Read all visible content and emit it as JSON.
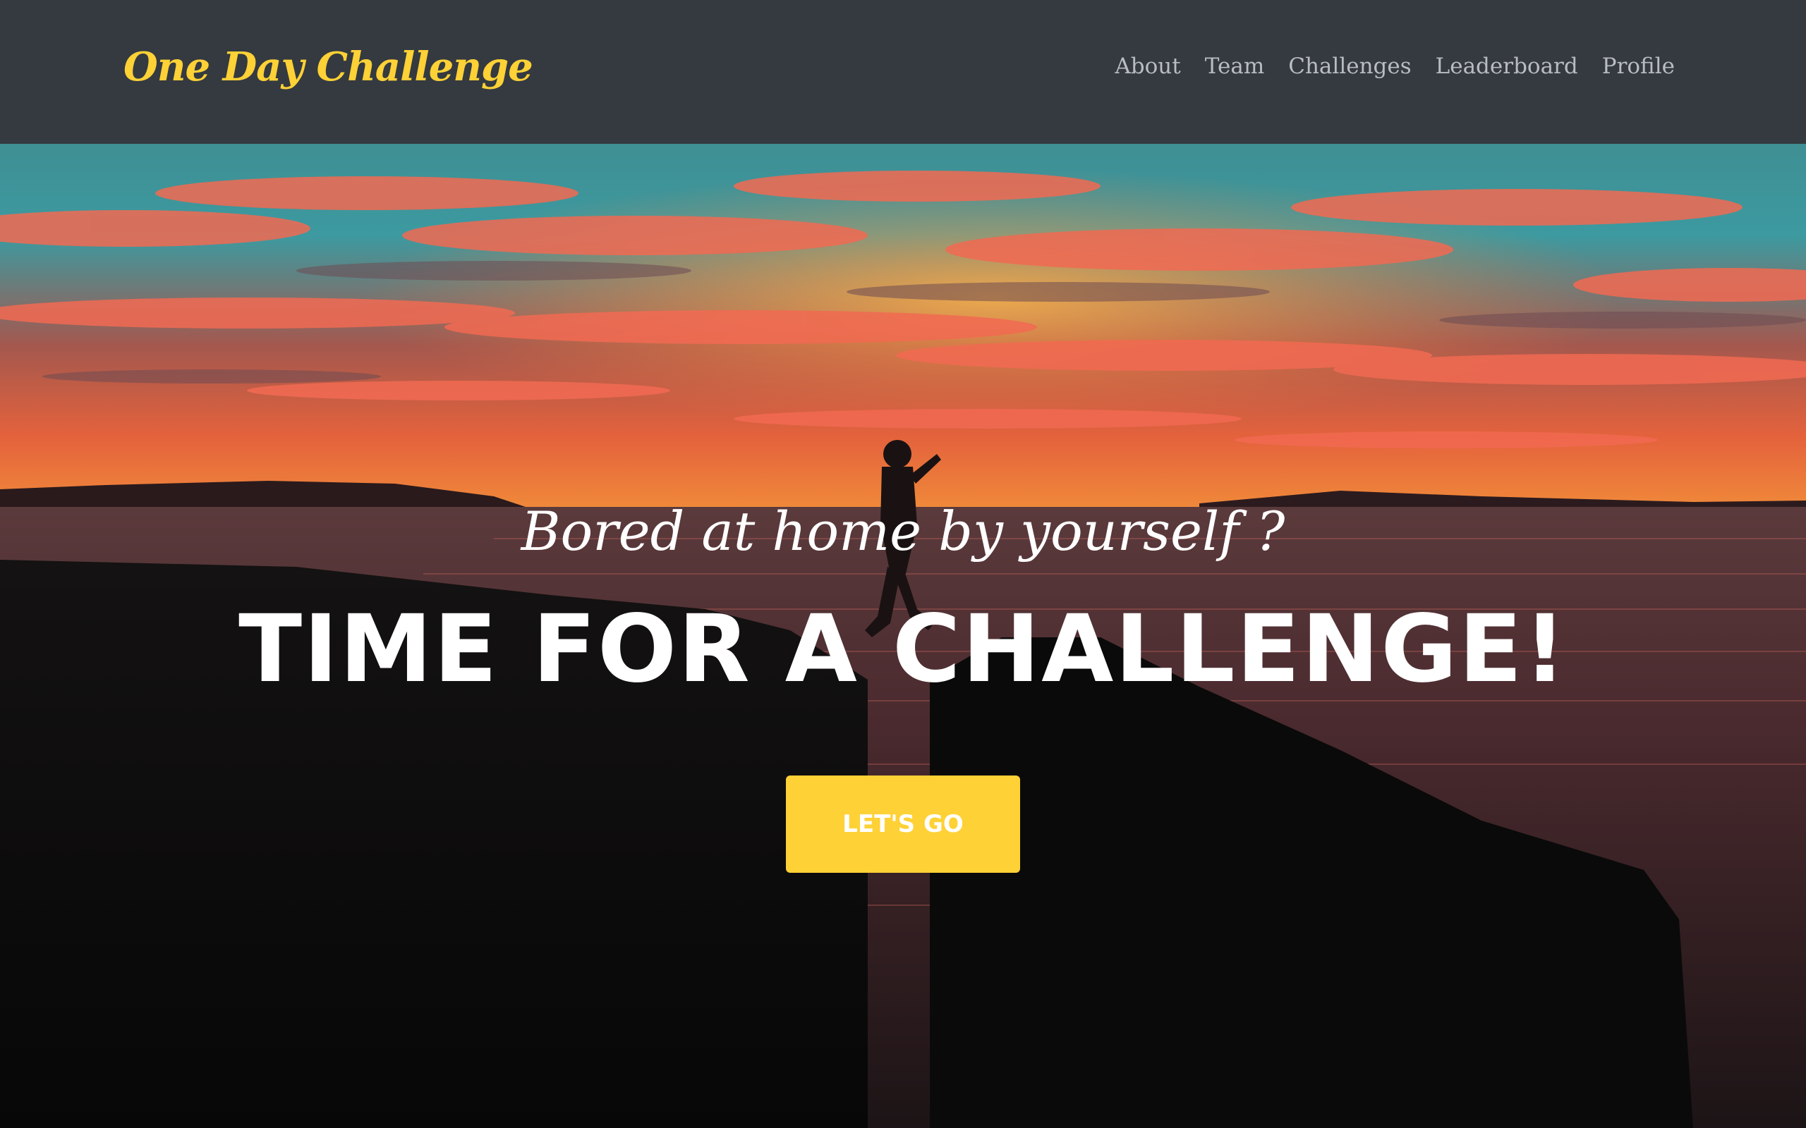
{
  "navbar": {
    "brand": "One Day Challenge",
    "links": [
      {
        "label": "About"
      },
      {
        "label": "Team"
      },
      {
        "label": "Challenges"
      },
      {
        "label": "Leaderboard"
      },
      {
        "label": "Profile"
      }
    ]
  },
  "hero": {
    "subheading": "Bored at home by yourself ?",
    "heading": "TIME FOR A CHALLENGE!",
    "cta_label": "LET'S GO",
    "background_description_icon": "sunset-cliff-jump-photo"
  },
  "colors": {
    "navbar_bg": "#343a40",
    "brand": "#fed136",
    "nav_link": "#b9bcc0",
    "cta_bg": "#fed136",
    "cta_text": "#ffffff",
    "hero_text": "#ffffff"
  }
}
